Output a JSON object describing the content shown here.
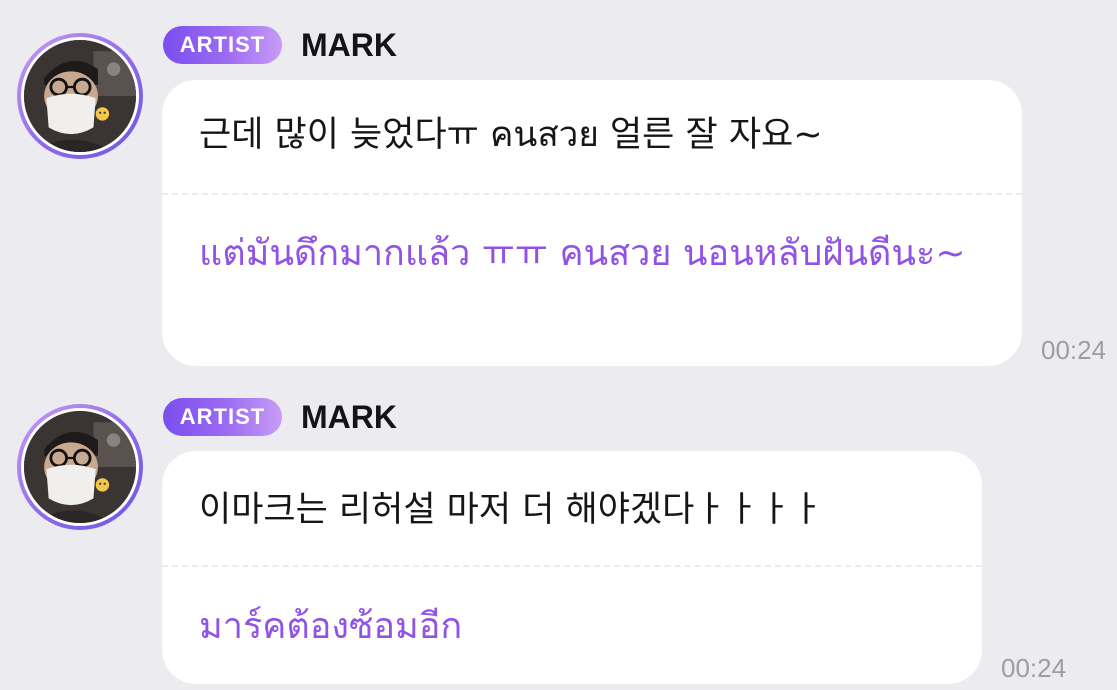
{
  "messages": [
    {
      "badge": "ARTIST",
      "sender": "MARK",
      "original": "근데 많이 늦었다ㅠ คนสวย 얼른 잘 자요~",
      "translation": "แต่มันดึกมากแล้ว ㅠㅠ คนสวย นอนหลับฝันดีนะ~",
      "time": "00:24"
    },
    {
      "badge": "ARTIST",
      "sender": "MARK",
      "original": "이마크는 리허설 마저 더 해야겠다ㅏㅏㅏㅏ",
      "translation": "มาร์คต้องซ้อมอีก",
      "time": "00:24"
    }
  ]
}
